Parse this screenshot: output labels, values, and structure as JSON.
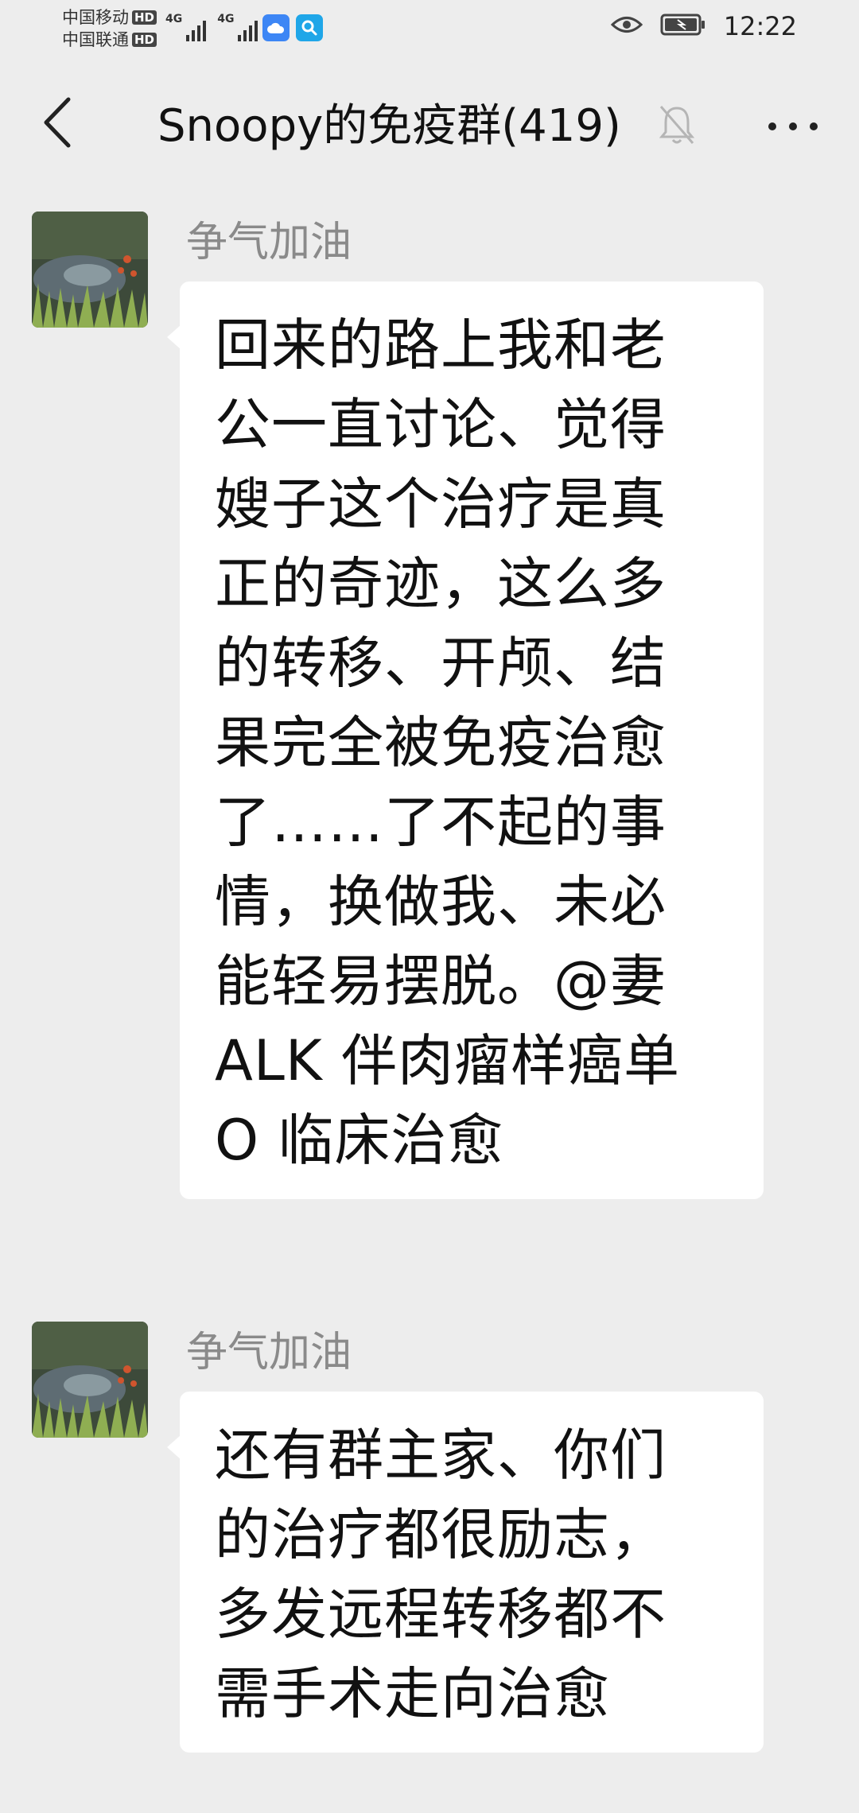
{
  "status_bar": {
    "carrier_1": "中国移动",
    "carrier_2": "中国联通",
    "hd": "HD",
    "network_1": "4G",
    "network_2": "4G",
    "time": "12:22"
  },
  "header": {
    "title": "Snoopy的免疫群(419)"
  },
  "messages": [
    {
      "sender": "争气加油",
      "text": "回来的路上我和老\n公一直讨论、觉得\n嫂子这个治疗是真\n正的奇迹，这么多\n的转移、开颅、结\n果完全被免疫治愈\n了……了不起的事\n情，换做我、未必\n能轻易摆脱。@妻\nALK 伴肉瘤样癌单\nO 临床治愈"
    },
    {
      "sender": "争气加油",
      "text": "还有群主家、你们\n的治疗都很励志，\n多发远程转移都不\n需手术走向治愈"
    }
  ],
  "colors": {
    "background": "#ededed",
    "bubble": "#ffffff",
    "sender_name": "#8a8a8a"
  }
}
